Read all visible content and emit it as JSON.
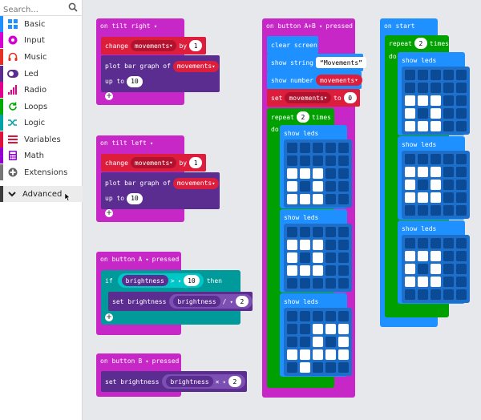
{
  "toolbox": {
    "search_placeholder": "Search...",
    "categories": [
      {
        "label": "Basic",
        "color": "#1e90ff"
      },
      {
        "label": "Input",
        "color": "#d400d4"
      },
      {
        "label": "Music",
        "color": "#e63022"
      },
      {
        "label": "Led",
        "color": "#5c2d91"
      },
      {
        "label": "Radio",
        "color": "#e3008c"
      },
      {
        "label": "Loops",
        "color": "#00aa00"
      },
      {
        "label": "Logic",
        "color": "#00a4a6"
      },
      {
        "label": "Variables",
        "color": "#dc143c"
      },
      {
        "label": "Math",
        "color": "#9400d3"
      },
      {
        "label": "Extensions",
        "color": "#777777"
      }
    ],
    "advanced_label": "Advanced"
  },
  "colors": {
    "input": "#c827c8",
    "variables": "#dc1e3c",
    "led": "#5c2d91",
    "basic": "#1e90ff",
    "loops": "#00a000",
    "logic": "#009a9a"
  },
  "blocks": {
    "tilt_right": {
      "hat": "on tilt right",
      "change": "change",
      "var": "movements",
      "by": "by",
      "by_value": "1",
      "plot": "plot bar graph of",
      "plot_var": "movements",
      "up_to": "up to",
      "up_to_value": "10"
    },
    "tilt_left": {
      "hat": "on tilt left",
      "change": "change",
      "var": "movements",
      "by": "by",
      "by_value": "1",
      "plot": "plot bar graph of",
      "plot_var": "movements",
      "up_to": "up to",
      "up_to_value": "10"
    },
    "button_a": {
      "hat": "on button",
      "button": "A",
      "pressed": "pressed",
      "if": "if",
      "brightness": "brightness",
      "op": ">",
      "value": "10",
      "then": "then",
      "set": "set brightness",
      "set_brightness": "brightness",
      "div": "/",
      "div_value": "2"
    },
    "button_b": {
      "hat": "on button",
      "button": "B",
      "pressed": "pressed",
      "set": "set brightness",
      "set_brightness": "brightness",
      "mul": "×",
      "mul_value": "2"
    },
    "button_ab": {
      "hat": "on button",
      "button": "A+B",
      "pressed": "pressed",
      "clear": "clear screen",
      "show_string": "show string",
      "string_value": "Movements",
      "show_number": "show number",
      "number_var": "movements",
      "set": "set",
      "set_var": "movements",
      "to": "to",
      "to_value": "0",
      "repeat": "repeat",
      "repeat_count": "2",
      "times": "times",
      "do": "do",
      "show_leds": "show leds"
    },
    "on_start": {
      "hat": "on start",
      "repeat": "repeat",
      "repeat_count": "2",
      "times": "times",
      "do": "do",
      "show_leds": "show leds"
    }
  },
  "led_patterns": {
    "ab_1": [
      0,
      0,
      0,
      0,
      0,
      0,
      0,
      0,
      0,
      0,
      1,
      1,
      1,
      0,
      0,
      1,
      0,
      1,
      0,
      0,
      1,
      1,
      1,
      0,
      0
    ],
    "ab_2": [
      0,
      0,
      0,
      0,
      0,
      1,
      1,
      1,
      0,
      0,
      1,
      0,
      1,
      0,
      0,
      1,
      1,
      1,
      0,
      0,
      0,
      0,
      0,
      0,
      0
    ],
    "ab_3": [
      0,
      0,
      0,
      0,
      0,
      0,
      0,
      1,
      1,
      1,
      0,
      0,
      1,
      0,
      1,
      1,
      1,
      1,
      1,
      1,
      0,
      1,
      0,
      0,
      0
    ],
    "start_1": [
      0,
      0,
      0,
      0,
      0,
      0,
      0,
      0,
      0,
      0,
      1,
      1,
      1,
      0,
      0,
      1,
      0,
      1,
      0,
      0,
      1,
      1,
      1,
      0,
      0
    ],
    "start_2": [
      0,
      0,
      0,
      0,
      0,
      1,
      1,
      1,
      0,
      0,
      1,
      0,
      1,
      0,
      0,
      1,
      1,
      1,
      0,
      0,
      0,
      0,
      0,
      0,
      0
    ],
    "start_3": [
      0,
      0,
      0,
      0,
      0,
      1,
      1,
      1,
      0,
      0,
      1,
      0,
      1,
      0,
      0,
      1,
      1,
      1,
      0,
      0,
      0,
      0,
      0,
      0,
      0
    ]
  }
}
